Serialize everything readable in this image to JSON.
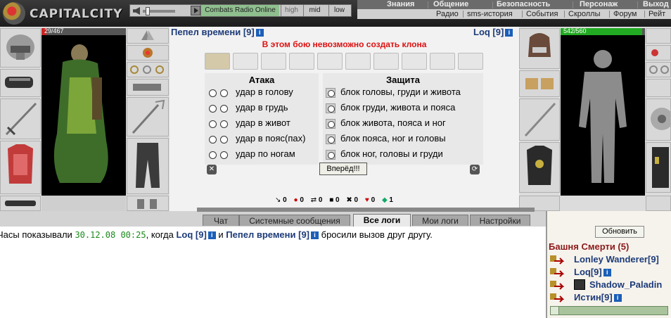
{
  "topbar": {
    "logo_text": "CAPITALCITY",
    "radio": {
      "station": "Combats Radio Online",
      "high": "high",
      "mid": "mid",
      "low": "low"
    },
    "menu_main": [
      "Знания",
      "Общение",
      "Безопасность",
      "Персонаж",
      "Выход"
    ],
    "menu_sub": [
      "Радио",
      "sms-история",
      "События",
      "Скроллы",
      "Форум",
      "Рейт"
    ]
  },
  "left_char": {
    "hp": "29/467",
    "hp_color": "#cc2222"
  },
  "right_char": {
    "hp": "542/560",
    "hp_color": "#22aa22"
  },
  "battle": {
    "player_name": "Пепел времени [9]",
    "enemy_name": "Loq [9]",
    "clone_message": "В этом бою невозможно создать клона",
    "attack_header": "Атака",
    "defense_header": "Защита",
    "attacks": [
      "удар в голову",
      "удар в грудь",
      "удар в живот",
      "удар в пояс(пах)",
      "удар по ногам"
    ],
    "defenses": [
      "блок головы, груди и живота",
      "блок груди, живота и пояса",
      "блок живота, пояса и ног",
      "блок пояса, ног и головы",
      "блок ног, головы и груди"
    ],
    "forward_button": "Вперёд!!!",
    "stats": [
      "0",
      "0",
      "0",
      "0",
      "0",
      "0",
      "1"
    ]
  },
  "log_tabs": [
    "Чат",
    "Системные сообщения",
    "Все логи",
    "Мои логи",
    "Настройки"
  ],
  "active_tab": "Все логи",
  "chat": {
    "prefix": "Часы показывали ",
    "time": "30.12.08 00:25",
    "mid1": ", когда ",
    "nick1": "Loq [9]",
    "mid2": " и ",
    "nick2": "Пепел времени [9]",
    "suffix": " бросили вызов друг другу."
  },
  "sidebar": {
    "refresh_button": "Обновить",
    "room_title": "Башня Смерти (5)",
    "players": [
      "Lonley Wanderer[9]",
      "Loq[9]",
      "Shadow_Paladin",
      "Истин[9]"
    ]
  }
}
